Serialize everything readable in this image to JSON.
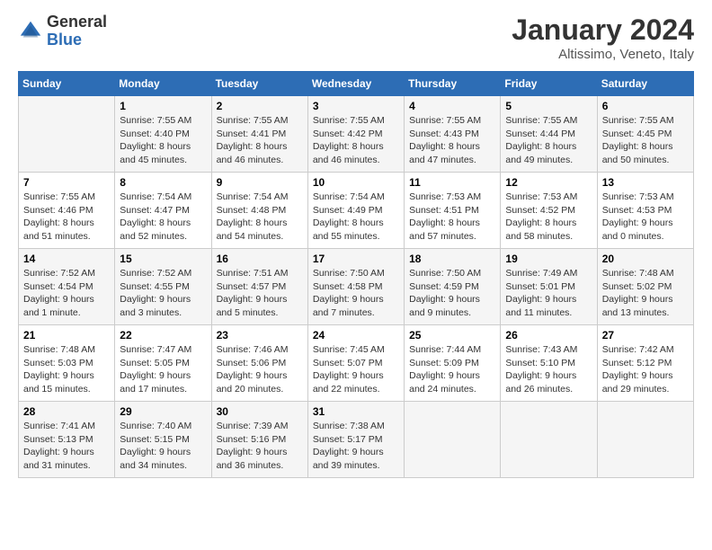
{
  "header": {
    "logo_general": "General",
    "logo_blue": "Blue",
    "month_title": "January 2024",
    "subtitle": "Altissimo, Veneto, Italy"
  },
  "days_of_week": [
    "Sunday",
    "Monday",
    "Tuesday",
    "Wednesday",
    "Thursday",
    "Friday",
    "Saturday"
  ],
  "weeks": [
    [
      {
        "day": "",
        "sunrise": "",
        "sunset": "",
        "daylight": ""
      },
      {
        "day": "1",
        "sunrise": "Sunrise: 7:55 AM",
        "sunset": "Sunset: 4:40 PM",
        "daylight": "Daylight: 8 hours and 45 minutes."
      },
      {
        "day": "2",
        "sunrise": "Sunrise: 7:55 AM",
        "sunset": "Sunset: 4:41 PM",
        "daylight": "Daylight: 8 hours and 46 minutes."
      },
      {
        "day": "3",
        "sunrise": "Sunrise: 7:55 AM",
        "sunset": "Sunset: 4:42 PM",
        "daylight": "Daylight: 8 hours and 46 minutes."
      },
      {
        "day": "4",
        "sunrise": "Sunrise: 7:55 AM",
        "sunset": "Sunset: 4:43 PM",
        "daylight": "Daylight: 8 hours and 47 minutes."
      },
      {
        "day": "5",
        "sunrise": "Sunrise: 7:55 AM",
        "sunset": "Sunset: 4:44 PM",
        "daylight": "Daylight: 8 hours and 49 minutes."
      },
      {
        "day": "6",
        "sunrise": "Sunrise: 7:55 AM",
        "sunset": "Sunset: 4:45 PM",
        "daylight": "Daylight: 8 hours and 50 minutes."
      }
    ],
    [
      {
        "day": "7",
        "sunrise": "Sunrise: 7:55 AM",
        "sunset": "Sunset: 4:46 PM",
        "daylight": "Daylight: 8 hours and 51 minutes."
      },
      {
        "day": "8",
        "sunrise": "Sunrise: 7:54 AM",
        "sunset": "Sunset: 4:47 PM",
        "daylight": "Daylight: 8 hours and 52 minutes."
      },
      {
        "day": "9",
        "sunrise": "Sunrise: 7:54 AM",
        "sunset": "Sunset: 4:48 PM",
        "daylight": "Daylight: 8 hours and 54 minutes."
      },
      {
        "day": "10",
        "sunrise": "Sunrise: 7:54 AM",
        "sunset": "Sunset: 4:49 PM",
        "daylight": "Daylight: 8 hours and 55 minutes."
      },
      {
        "day": "11",
        "sunrise": "Sunrise: 7:53 AM",
        "sunset": "Sunset: 4:51 PM",
        "daylight": "Daylight: 8 hours and 57 minutes."
      },
      {
        "day": "12",
        "sunrise": "Sunrise: 7:53 AM",
        "sunset": "Sunset: 4:52 PM",
        "daylight": "Daylight: 8 hours and 58 minutes."
      },
      {
        "day": "13",
        "sunrise": "Sunrise: 7:53 AM",
        "sunset": "Sunset: 4:53 PM",
        "daylight": "Daylight: 9 hours and 0 minutes."
      }
    ],
    [
      {
        "day": "14",
        "sunrise": "Sunrise: 7:52 AM",
        "sunset": "Sunset: 4:54 PM",
        "daylight": "Daylight: 9 hours and 1 minute."
      },
      {
        "day": "15",
        "sunrise": "Sunrise: 7:52 AM",
        "sunset": "Sunset: 4:55 PM",
        "daylight": "Daylight: 9 hours and 3 minutes."
      },
      {
        "day": "16",
        "sunrise": "Sunrise: 7:51 AM",
        "sunset": "Sunset: 4:57 PM",
        "daylight": "Daylight: 9 hours and 5 minutes."
      },
      {
        "day": "17",
        "sunrise": "Sunrise: 7:50 AM",
        "sunset": "Sunset: 4:58 PM",
        "daylight": "Daylight: 9 hours and 7 minutes."
      },
      {
        "day": "18",
        "sunrise": "Sunrise: 7:50 AM",
        "sunset": "Sunset: 4:59 PM",
        "daylight": "Daylight: 9 hours and 9 minutes."
      },
      {
        "day": "19",
        "sunrise": "Sunrise: 7:49 AM",
        "sunset": "Sunset: 5:01 PM",
        "daylight": "Daylight: 9 hours and 11 minutes."
      },
      {
        "day": "20",
        "sunrise": "Sunrise: 7:48 AM",
        "sunset": "Sunset: 5:02 PM",
        "daylight": "Daylight: 9 hours and 13 minutes."
      }
    ],
    [
      {
        "day": "21",
        "sunrise": "Sunrise: 7:48 AM",
        "sunset": "Sunset: 5:03 PM",
        "daylight": "Daylight: 9 hours and 15 minutes."
      },
      {
        "day": "22",
        "sunrise": "Sunrise: 7:47 AM",
        "sunset": "Sunset: 5:05 PM",
        "daylight": "Daylight: 9 hours and 17 minutes."
      },
      {
        "day": "23",
        "sunrise": "Sunrise: 7:46 AM",
        "sunset": "Sunset: 5:06 PM",
        "daylight": "Daylight: 9 hours and 20 minutes."
      },
      {
        "day": "24",
        "sunrise": "Sunrise: 7:45 AM",
        "sunset": "Sunset: 5:07 PM",
        "daylight": "Daylight: 9 hours and 22 minutes."
      },
      {
        "day": "25",
        "sunrise": "Sunrise: 7:44 AM",
        "sunset": "Sunset: 5:09 PM",
        "daylight": "Daylight: 9 hours and 24 minutes."
      },
      {
        "day": "26",
        "sunrise": "Sunrise: 7:43 AM",
        "sunset": "Sunset: 5:10 PM",
        "daylight": "Daylight: 9 hours and 26 minutes."
      },
      {
        "day": "27",
        "sunrise": "Sunrise: 7:42 AM",
        "sunset": "Sunset: 5:12 PM",
        "daylight": "Daylight: 9 hours and 29 minutes."
      }
    ],
    [
      {
        "day": "28",
        "sunrise": "Sunrise: 7:41 AM",
        "sunset": "Sunset: 5:13 PM",
        "daylight": "Daylight: 9 hours and 31 minutes."
      },
      {
        "day": "29",
        "sunrise": "Sunrise: 7:40 AM",
        "sunset": "Sunset: 5:15 PM",
        "daylight": "Daylight: 9 hours and 34 minutes."
      },
      {
        "day": "30",
        "sunrise": "Sunrise: 7:39 AM",
        "sunset": "Sunset: 5:16 PM",
        "daylight": "Daylight: 9 hours and 36 minutes."
      },
      {
        "day": "31",
        "sunrise": "Sunrise: 7:38 AM",
        "sunset": "Sunset: 5:17 PM",
        "daylight": "Daylight: 9 hours and 39 minutes."
      },
      {
        "day": "",
        "sunrise": "",
        "sunset": "",
        "daylight": ""
      },
      {
        "day": "",
        "sunrise": "",
        "sunset": "",
        "daylight": ""
      },
      {
        "day": "",
        "sunrise": "",
        "sunset": "",
        "daylight": ""
      }
    ]
  ]
}
